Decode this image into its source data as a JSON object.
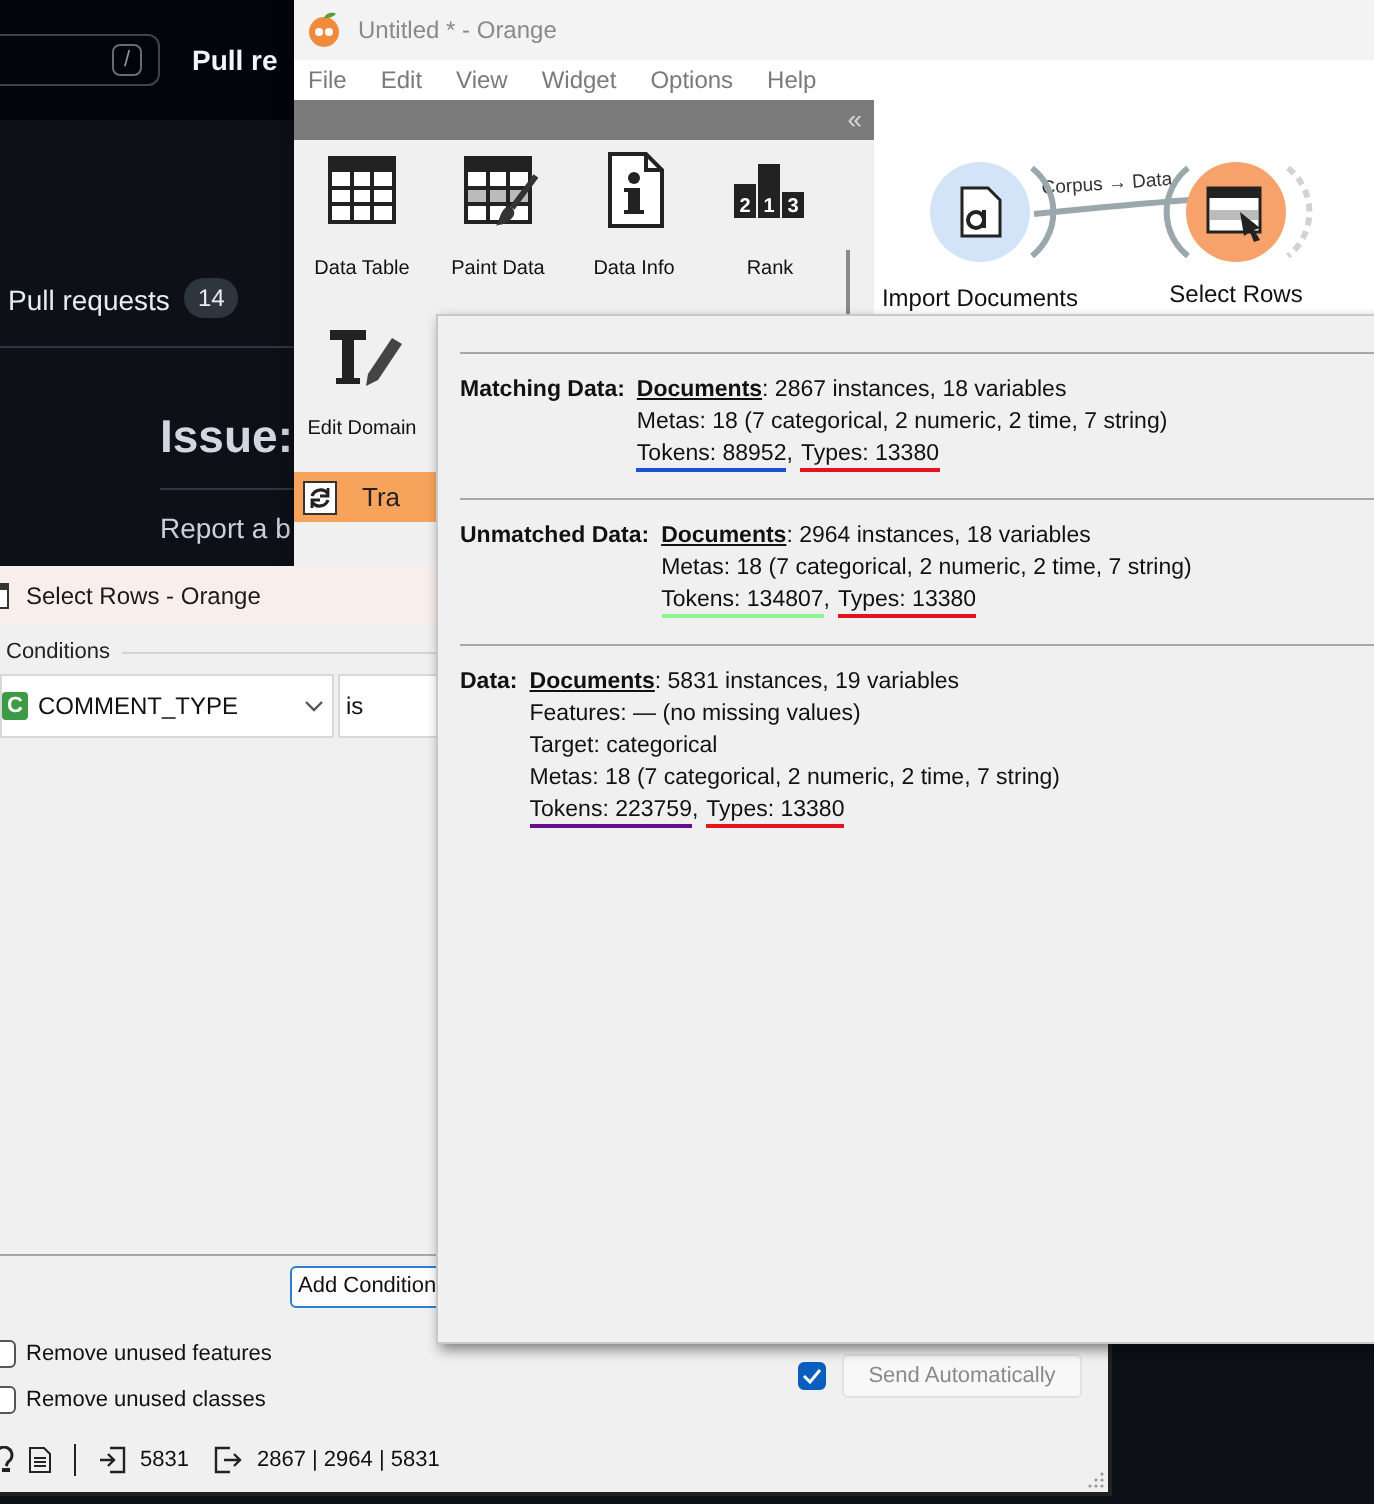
{
  "background_page": {
    "search_key": "/",
    "header_link": "Pull re",
    "nav": [
      {
        "label": "Pull requests",
        "count": "14"
      }
    ],
    "issue_title": "Issue:",
    "issue_text": "Report a b"
  },
  "main_window": {
    "title": "Untitled * - Orange",
    "menu": [
      "File",
      "Edit",
      "View",
      "Widget",
      "Options",
      "Help"
    ],
    "toolbox": {
      "collapse": "«",
      "widgets": [
        {
          "label": "Data Table",
          "kind": "table"
        },
        {
          "label": "Paint Data",
          "kind": "paint"
        },
        {
          "label": "Data Info",
          "kind": "info"
        },
        {
          "label": "Rank",
          "kind": "rank",
          "digits": [
            "2",
            "1",
            "3"
          ]
        },
        {
          "label": "Edit Domain",
          "kind": "edit"
        }
      ],
      "category": {
        "label": "Tra"
      }
    },
    "canvas": {
      "nodes": [
        {
          "label": "Import Documents",
          "kind": "import"
        },
        {
          "label": "Select Rows",
          "kind": "select"
        }
      ],
      "link_label": "Corpus → Data"
    }
  },
  "select_rows": {
    "title": "Select Rows - Orange",
    "conditions_label": "Conditions",
    "conditions": [
      {
        "type_badge": "C",
        "variable": "COMMENT_TYPE",
        "operator": "is"
      }
    ],
    "add_button": "Add Condition",
    "options": [
      {
        "label": "Remove unused features",
        "checked": false
      },
      {
        "label": "Remove unused classes",
        "checked": false
      }
    ],
    "auto_send": {
      "label": "Send Automatically",
      "checked": true
    },
    "status": {
      "input": "5831",
      "output": "2867 | 2964 | 5831"
    }
  },
  "info_popup": {
    "sections": [
      {
        "label": "Matching Data:",
        "lines": [
          {
            "kind": "text",
            "text": "**Documents**: 2867 instances, 18 variables"
          },
          {
            "kind": "text",
            "text": "Metas: 18 (7 categorical, 2 numeric, 2 time, 7 string)"
          },
          {
            "kind": "tokens",
            "parts": [
              {
                "text": "Tokens: 88952",
                "color": "#1a4fd8"
              },
              {
                "text": ","
              },
              {
                "text": "Types: 13380",
                "color": "#e3141b"
              }
            ]
          }
        ]
      },
      {
        "label": "Unmatched Data:",
        "lines": [
          {
            "kind": "text",
            "text": "**Documents**: 2964 instances, 18 variables"
          },
          {
            "kind": "text",
            "text": "Metas: 18 (7 categorical, 2 numeric, 2 time, 7 string)"
          },
          {
            "kind": "tokens",
            "parts": [
              {
                "text": "Tokens: 134807",
                "color": "#8df58d"
              },
              {
                "text": ","
              },
              {
                "text": "Types: 13380",
                "color": "#e3141b"
              }
            ]
          }
        ]
      },
      {
        "label": "Data:",
        "lines": [
          {
            "kind": "text",
            "text": "**Documents**: 5831 instances, 19 variables"
          },
          {
            "kind": "text",
            "text": "Features: — (no missing values)"
          },
          {
            "kind": "text",
            "text": "Target: categorical"
          },
          {
            "kind": "text",
            "text": "Metas: 18 (7 categorical, 2 numeric, 2 time, 7 string)"
          },
          {
            "kind": "tokens",
            "parts": [
              {
                "text": "Tokens: 223759",
                "color": "#6a0f8a"
              },
              {
                "text": ","
              },
              {
                "text": "Types: 13380",
                "color": "#e3141b"
              }
            ]
          }
        ]
      }
    ]
  }
}
